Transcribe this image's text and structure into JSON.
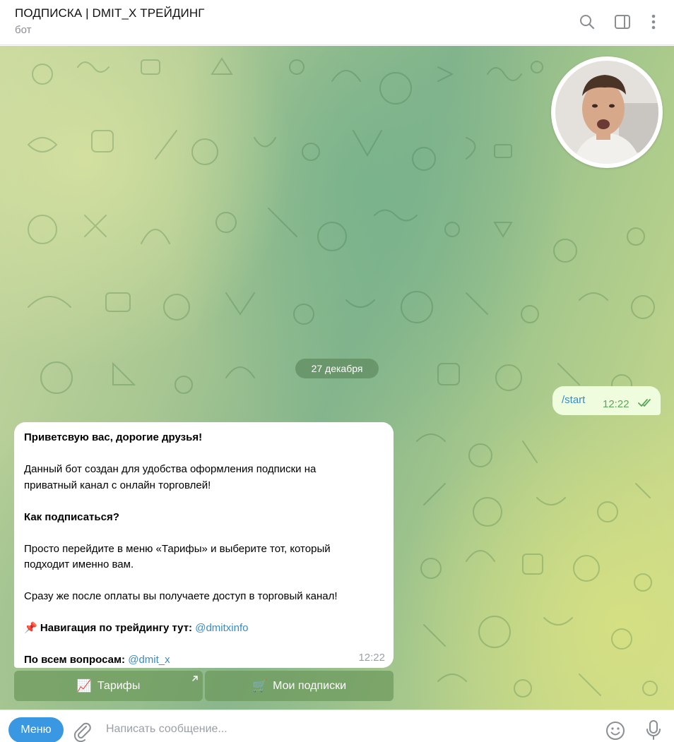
{
  "header": {
    "title": "ПОДПИСКА | DMIT_X ТРЕЙДИНГ",
    "subtitle": "бот",
    "icons": [
      "search-icon",
      "sidebar-toggle-icon",
      "more-vertical-icon"
    ]
  },
  "chat": {
    "date_label": "27 декабря",
    "outgoing": {
      "text": "/start",
      "time": "12:22",
      "status": "read"
    },
    "incoming": {
      "greeting": "Приветсвую вас, дорогие друзья!",
      "intro_line1": "Данный бот создан для удобства оформления подписки на",
      "intro_line2": "приватный канал с онлайн торговлей!",
      "howto_heading": "Как подписаться?",
      "howto_line1": "Просто перейдите в меню «Тарифы» и выберите тот, который",
      "howto_line2": "подходит именно вам.",
      "after_payment": "Сразу же после оплаты вы получаете доступ в торговый канал!",
      "nav_emoji": "📌",
      "nav_label": "Навигация по трейдингу тут:",
      "nav_link": "@dmitxinfo",
      "questions_label": "По всем вопросам:",
      "questions_link": "@dmit_x",
      "time": "12:22"
    },
    "keyboard": [
      {
        "emoji": "📈",
        "label": "Тарифы",
        "icon": "external-arrow-icon"
      },
      {
        "emoji": "🛒",
        "label": "Мои подписки"
      }
    ]
  },
  "composer": {
    "menu_label": "Меню",
    "placeholder": "Написать сообщение...",
    "icons": [
      "paperclip-icon",
      "emoji-icon",
      "microphone-icon"
    ]
  },
  "colors": {
    "accent": "#3a97e1",
    "link": "#3a8ac4",
    "outgoing_bubble": "#effdde",
    "read_ticks": "#5ea45a"
  }
}
